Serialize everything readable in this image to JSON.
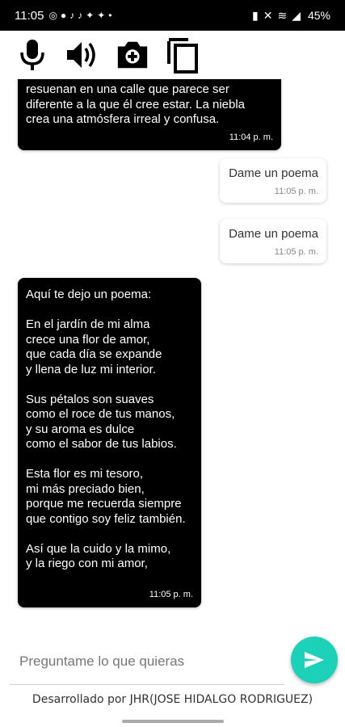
{
  "status_bar": {
    "time": "11:05",
    "left_icons": [
      "whatsapp-icon",
      "facebook-icon",
      "tiktok-icon",
      "tiktok-icon",
      "twitter-icon",
      "twitter-icon",
      "dot-icon"
    ],
    "battery": "45%"
  },
  "toolbar": {
    "icons": [
      "microphone-icon",
      "speaker-icon",
      "camera-icon",
      "copy-icon"
    ]
  },
  "messages": [
    {
      "from": "bot",
      "text": "resuenan en una calle que parece ser\ndiferente a la que él cree estar. La niebla\ncrea una atmósfera irreal y confusa.",
      "time": "11:04 p. m."
    },
    {
      "from": "user",
      "text": "Dame un poema",
      "time": "11:05 p. m."
    },
    {
      "from": "user",
      "text": "Dame un poema",
      "time": "11:05 p. m."
    },
    {
      "from": "bot",
      "text": "Aquí te dejo un poema:\n\nEn el jardín de mi alma\ncrece una flor de amor,\nque cada día se expande\ny llena de luz mi interior.\n\nSus pétalos son suaves\ncomo el roce de tus manos,\ny su aroma es dulce\ncomo el sabor de tus labios.\n\nEsta flor es mi tesoro,\nmi más preciado bien,\nporque me recuerda siempre\nque contigo soy feliz también.\n\nAsí que la cuido y la mimo,\ny la riego con mi amor,",
      "time": "11:05 p. m."
    }
  ],
  "input": {
    "placeholder": "Preguntame lo que quieras"
  },
  "footer": {
    "credit": "Desarrollado por JHR(JOSE HIDALGO RODRIGUEZ)"
  },
  "colors": {
    "accent": "#1dd1b8",
    "bot_bubble": "#000000",
    "user_bubble": "#ffffff"
  }
}
